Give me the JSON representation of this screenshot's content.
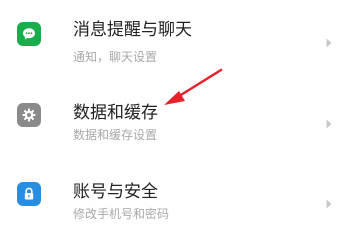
{
  "settings": {
    "items": [
      {
        "title": "消息提醒与聊天",
        "subtitle": "通知，聊天设置",
        "icon": "chat-bubble-icon",
        "icon_color": "#1aad4b"
      },
      {
        "title": "数据和缓存",
        "subtitle": "数据和缓存设置",
        "icon": "gear-icon",
        "icon_color": "#8a8a8a"
      },
      {
        "title": "账号与安全",
        "subtitle": "修改手机号和密码",
        "icon": "lock-icon",
        "icon_color": "#2a8ee0"
      }
    ]
  },
  "colors": {
    "annotation_arrow": "#e8202a",
    "chevron": "#c8c8c8",
    "title_text": "#222222",
    "subtitle_text": "#a8a8a8"
  }
}
